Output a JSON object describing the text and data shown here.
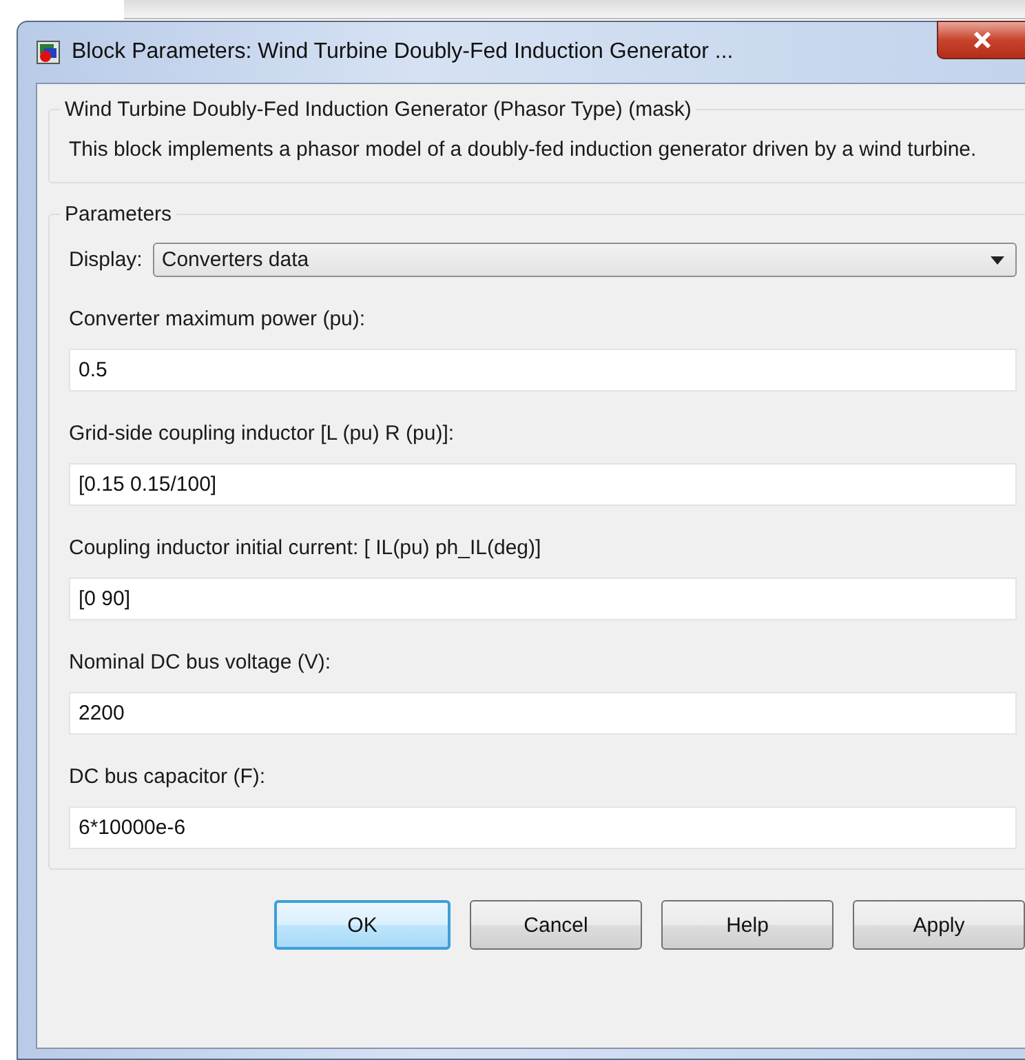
{
  "window": {
    "title": "Block Parameters: Wind Turbine Doubly-Fed Induction Generator ..."
  },
  "description_group": {
    "title": "Wind Turbine Doubly-Fed Induction Generator (Phasor Type) (mask)",
    "text": "This block implements a phasor model of a doubly-fed induction generator driven by a wind turbine."
  },
  "parameters": {
    "title": "Parameters",
    "display": {
      "label": "Display:",
      "value": "Converters data"
    },
    "fields": [
      {
        "label": "Converter maximum power (pu):",
        "value": "0.5"
      },
      {
        "label": "Grid-side coupling inductor [L (pu) R (pu)]:",
        "value": "[0.15 0.15/100]"
      },
      {
        "label": "Coupling inductor initial current: [ IL(pu) ph_IL(deg)]",
        "value": "[0 90]"
      },
      {
        "label": "Nominal DC bus voltage (V):",
        "value": "2200"
      },
      {
        "label": "DC bus capacitor (F):",
        "value": "6*10000e-6"
      }
    ]
  },
  "buttons": [
    {
      "label": "OK",
      "default": true
    },
    {
      "label": "Cancel",
      "default": false
    },
    {
      "label": "Help",
      "default": false
    },
    {
      "label": "Apply",
      "default": false
    }
  ]
}
